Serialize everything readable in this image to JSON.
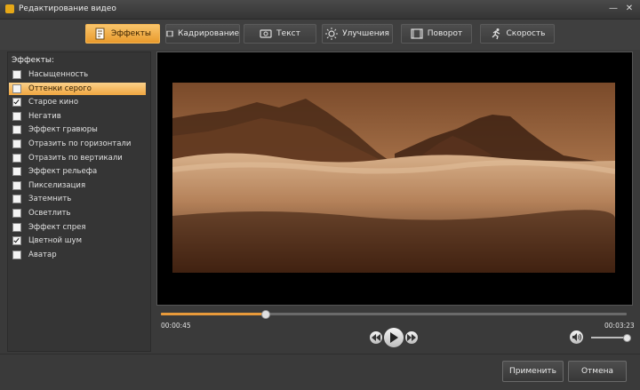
{
  "window": {
    "title": "Редактирование видео",
    "minimize_glyph": "—",
    "close_glyph": "✕"
  },
  "tabs": [
    {
      "label": "Эффекты",
      "icon": "effects-icon",
      "active": true
    },
    {
      "label": "Кадрирование",
      "icon": "film-crop-icon",
      "active": false
    },
    {
      "label": "Текст",
      "icon": "text-icon",
      "active": false
    },
    {
      "label": "Улучшения",
      "icon": "sun-icon",
      "active": false
    },
    {
      "label": "Поворот",
      "icon": "film-rotate-icon",
      "active": false
    },
    {
      "label": "Скорость",
      "icon": "runner-icon",
      "active": false
    }
  ],
  "effects": {
    "heading": "Эффекты:",
    "items": [
      {
        "label": "Насыщенность",
        "checked": false,
        "selected": false
      },
      {
        "label": "Оттенки серого",
        "checked": false,
        "selected": true
      },
      {
        "label": "Старое кино",
        "checked": true,
        "selected": false
      },
      {
        "label": "Негатив",
        "checked": false,
        "selected": false
      },
      {
        "label": "Эффект гравюры",
        "checked": false,
        "selected": false
      },
      {
        "label": "Отразить по горизонтали",
        "checked": false,
        "selected": false
      },
      {
        "label": "Отразить по вертикали",
        "checked": false,
        "selected": false
      },
      {
        "label": "Эффект рельефа",
        "checked": false,
        "selected": false
      },
      {
        "label": "Пикселизация",
        "checked": false,
        "selected": false
      },
      {
        "label": "Затемнить",
        "checked": false,
        "selected": false
      },
      {
        "label": "Осветлить",
        "checked": false,
        "selected": false
      },
      {
        "label": "Эффект спрея",
        "checked": false,
        "selected": false
      },
      {
        "label": "Цветной шум",
        "checked": true,
        "selected": false
      },
      {
        "label": "Аватар",
        "checked": false,
        "selected": false
      }
    ]
  },
  "player": {
    "current_time": "00:00:45",
    "total_time": "00:03:23",
    "progress": 0.225,
    "volume": 1.0
  },
  "footer": {
    "apply_label": "Применить",
    "cancel_label": "Отмена"
  },
  "colors": {
    "accent": "#f0a641",
    "sepia": "#a0653a"
  }
}
